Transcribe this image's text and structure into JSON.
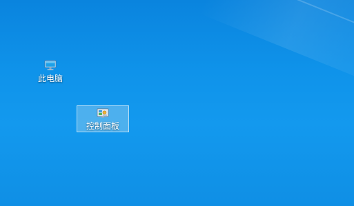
{
  "desktop": {
    "icons": [
      {
        "label": "此电脑",
        "icon": "this-pc-icon",
        "selected": false
      },
      {
        "label": "控制面板",
        "icon": "control-panel-icon",
        "selected": true
      }
    ]
  },
  "colors": {
    "wallpaper": "#0f93ea",
    "selection_fill": "#add8f0",
    "label_text": "#ffffff"
  }
}
